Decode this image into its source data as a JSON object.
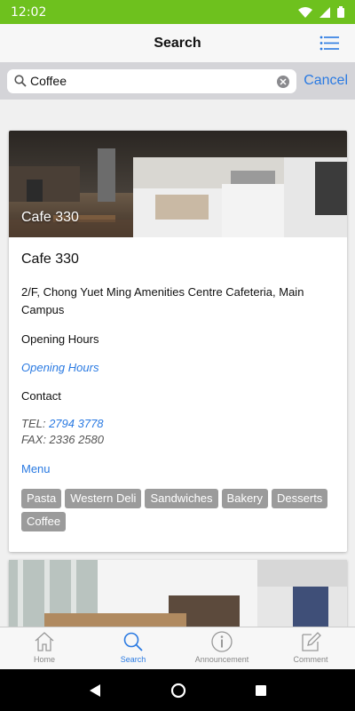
{
  "status_bar": {
    "time": "12:02",
    "bar_color": "#6ec11e"
  },
  "header": {
    "title": "Search",
    "menu_icon": "list-icon"
  },
  "search": {
    "value": "Coffee",
    "placeholder": "",
    "cancel_label": "Cancel"
  },
  "result": {
    "image_label": "Cafe 330",
    "title": "Cafe 330",
    "address": "2/F, Chong Yuet Ming Amenities Centre Cafeteria, Main Campus",
    "opening_hours_label": "Opening Hours",
    "opening_hours_link": "Opening Hours",
    "contact_label": "Contact",
    "tel_prefix": "TEL: ",
    "tel": "2794 3778",
    "fax": "FAX: 2336 2580",
    "menu_link": "Menu",
    "tags": [
      "Pasta",
      "Western Deli",
      "Sandwiches",
      "Bakery",
      "Desserts",
      "Coffee"
    ]
  },
  "tabs": [
    {
      "label": "Home",
      "icon": "home-icon",
      "active": false
    },
    {
      "label": "Search",
      "icon": "search-icon",
      "active": true
    },
    {
      "label": "Announcement",
      "icon": "info-icon",
      "active": false
    },
    {
      "label": "Comment",
      "icon": "compose-icon",
      "active": false
    }
  ],
  "colors": {
    "accent": "#2a7ae2",
    "tag_bg": "#9b9b9b"
  }
}
